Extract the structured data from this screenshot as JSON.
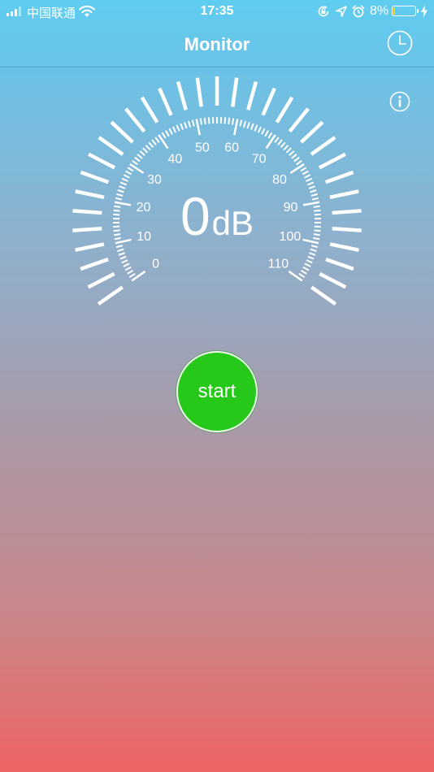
{
  "status_bar": {
    "carrier": "中国联通",
    "time": "17:35",
    "battery_percent": "8%",
    "battery_level": 0.08,
    "battery_color": "#f5d623",
    "icons": [
      "signal-icon",
      "wifi-icon",
      "orientation-lock-icon",
      "location-arrow-icon",
      "alarm-icon",
      "battery-icon",
      "charging-icon"
    ]
  },
  "nav": {
    "title": "Monitor",
    "history_icon": "clock-icon"
  },
  "info_icon": "info-icon",
  "gauge": {
    "value": "0",
    "unit": "dB",
    "min": 0,
    "max": 110,
    "labels": [
      0,
      10,
      20,
      30,
      40,
      50,
      60,
      70,
      80,
      90,
      100,
      110
    ]
  },
  "start_button": {
    "label": "start",
    "color": "#26c81a"
  }
}
